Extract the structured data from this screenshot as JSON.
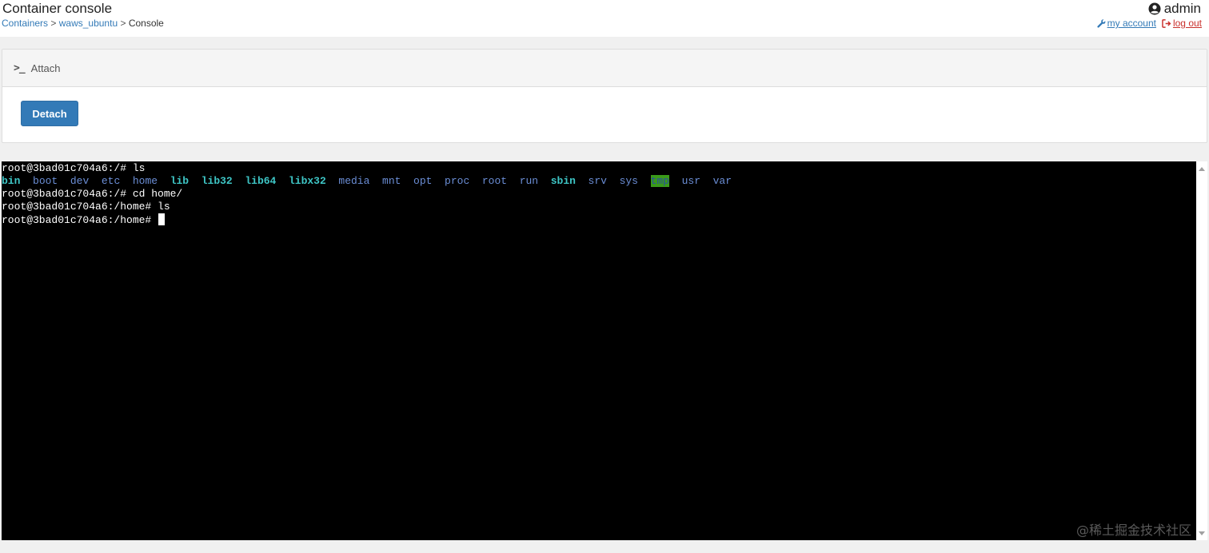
{
  "header": {
    "title": "Container console",
    "breadcrumb": {
      "items": [
        {
          "label": "Containers"
        },
        {
          "label": "waws_ubuntu"
        },
        {
          "label": "Console"
        }
      ],
      "separator": ">"
    },
    "user": {
      "name": "admin",
      "icon": "user-circle-icon",
      "my_account_label": "my account",
      "my_account_icon": "wrench-icon",
      "logout_label": "log out",
      "logout_icon": "sign-out-icon"
    }
  },
  "attach_panel": {
    "icon": "terminal-prompt-icon",
    "icon_glyph": ">_",
    "heading": "Attach",
    "detach_button_label": "Detach"
  },
  "terminal": {
    "lines": [
      "root@3bad01c704a6:/# ls",
      null,
      "root@3bad01c704a6:/# cd home/",
      "root@3bad01c704a6:/home# ls",
      "root@3bad01c704a6:/home# "
    ],
    "ls_output": [
      {
        "name": "bin",
        "type": "link"
      },
      {
        "name": "boot",
        "type": "dir"
      },
      {
        "name": "dev",
        "type": "dir"
      },
      {
        "name": "etc",
        "type": "dir"
      },
      {
        "name": "home",
        "type": "dir"
      },
      {
        "name": "lib",
        "type": "link"
      },
      {
        "name": "lib32",
        "type": "link"
      },
      {
        "name": "lib64",
        "type": "link"
      },
      {
        "name": "libx32",
        "type": "link"
      },
      {
        "name": "media",
        "type": "dir"
      },
      {
        "name": "mnt",
        "type": "dir"
      },
      {
        "name": "opt",
        "type": "dir"
      },
      {
        "name": "proc",
        "type": "dir"
      },
      {
        "name": "root",
        "type": "dir"
      },
      {
        "name": "run",
        "type": "dir"
      },
      {
        "name": "sbin",
        "type": "link"
      },
      {
        "name": "srv",
        "type": "dir"
      },
      {
        "name": "sys",
        "type": "dir"
      },
      {
        "name": "tmp",
        "type": "sticky"
      },
      {
        "name": "usr",
        "type": "dir"
      },
      {
        "name": "var",
        "type": "dir"
      }
    ],
    "watermark": "@稀土掘金技术社区"
  },
  "colors": {
    "link_blue": "#337ab7",
    "logout_red": "#c9302c",
    "button_primary": "#337ab7",
    "terminal_bg": "#000000",
    "ls_dir": "#6b8ed6",
    "ls_link": "#3ec6c6",
    "ls_sticky_bg": "#3a9a1a"
  }
}
